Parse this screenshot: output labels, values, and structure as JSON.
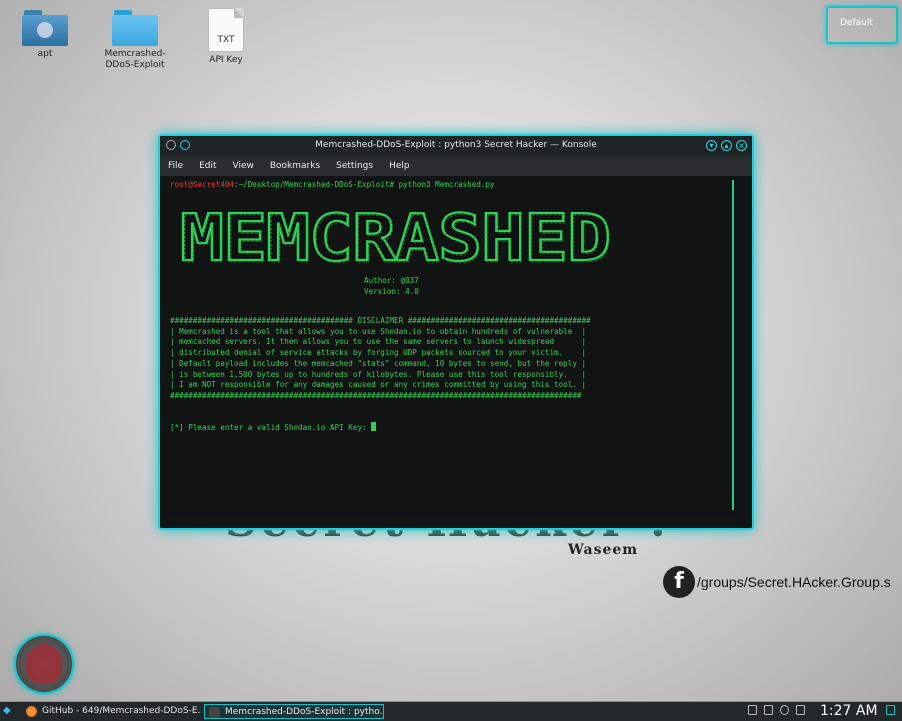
{
  "desktop": {
    "icons": [
      {
        "label": "apt",
        "kind": "folder-special"
      },
      {
        "label": "Memcrashed-\nDDoS-Exploit",
        "kind": "folder"
      },
      {
        "label": "API Key",
        "kind": "text-file",
        "badge": "TXT"
      }
    ],
    "activities_label": "Default",
    "watermark_title": "Secret Hacker !",
    "watermark_sub": "Waseem",
    "facebook_text": "/groups/Secret.HAcker.Group.s"
  },
  "window": {
    "title": "Memcrashed-DDoS-Exploit : python3 Secret Hacker — Konsole",
    "menu": [
      "File",
      "Edit",
      "View",
      "Bookmarks",
      "Settings",
      "Help"
    ]
  },
  "terminal": {
    "prompt_user": "root@Secret404",
    "prompt_path": ":~/Desktop/Memcrashed-DDoS-Exploit# python3 Memcrashed.py",
    "banner": "MEMCRASHED",
    "author": "Author: @037",
    "version": "Version: 4.0",
    "disclaimer": "######################################## DISCLAIMER ########################################\n| Memcrashed is a tool that allows you to use Shodan.io to obtain hundreds of vulnerable  |\n| memcached servers. It then allows you to use the same servers to launch widespread      |\n| distributed denial of service attacks by forging UDP packets sourced to your victim.    |\n| Default payload includes the memcached \"stats\" command, 10 bytes to send, but the reply |\n| is between 1,500 bytes up to hundreds of kilobytes. Please use this tool responsibly.   |\n| I am NOT responsible for any damages caused or any crimes committed by using this tool. |\n##########################################################################################",
    "ask": "[*] Please enter a valid Shodan.io API Key: "
  },
  "taskbar": {
    "tasks": [
      {
        "label": "GitHub - 649/Memcrashed-DDoS-E...",
        "icon": "firefox-icon",
        "active": false
      },
      {
        "label": "Memcrashed-DDoS-Exploit : pytho...",
        "icon": "konsole-icon",
        "active": true
      }
    ],
    "clock": "1:27 AM"
  },
  "colors": {
    "accent": "#19c2c9",
    "terminal_green": "#31d157",
    "prompt_red": "#e23b3b"
  }
}
